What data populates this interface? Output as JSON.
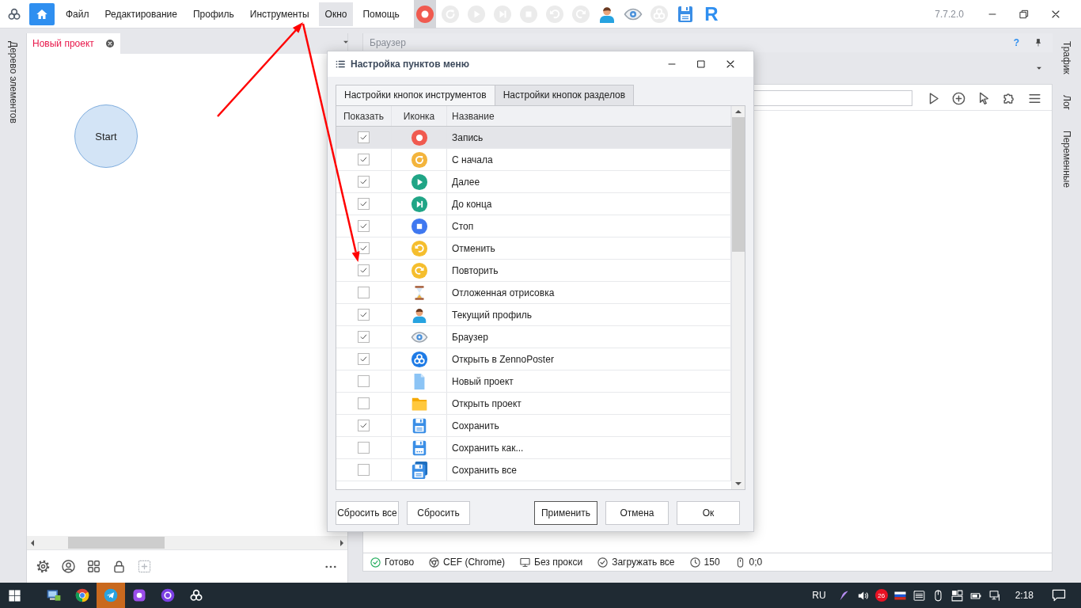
{
  "menu": [
    {
      "label": "Файл",
      "selected": false
    },
    {
      "label": "Редактирование",
      "selected": false
    },
    {
      "label": "Профиль",
      "selected": false
    },
    {
      "label": "Инструменты",
      "selected": false
    },
    {
      "label": "Окно",
      "selected": true
    },
    {
      "label": "Помощь",
      "selected": false
    }
  ],
  "toolbar": [
    {
      "kind": "record",
      "disabled": false,
      "selected": true
    },
    {
      "kind": "restart",
      "disabled": true,
      "selected": false
    },
    {
      "kind": "play",
      "disabled": true,
      "selected": false
    },
    {
      "kind": "toend",
      "disabled": true,
      "selected": false
    },
    {
      "kind": "stop",
      "disabled": true,
      "selected": false
    },
    {
      "kind": "undo",
      "disabled": true,
      "selected": false
    },
    {
      "kind": "redo",
      "disabled": true,
      "selected": false
    },
    {
      "kind": "person",
      "disabled": false,
      "selected": false
    },
    {
      "kind": "eye",
      "disabled": false,
      "selected": false
    },
    {
      "kind": "zenno",
      "disabled": true,
      "selected": false
    },
    {
      "kind": "save",
      "disabled": false,
      "selected": false
    },
    {
      "kind": "text-logo",
      "label": "R",
      "disabled": false,
      "selected": false
    }
  ],
  "version": "7.7.2.0",
  "left_sidebar": {
    "label": "Дерево элементов"
  },
  "project_tab": {
    "label": "Новый проект"
  },
  "canvas": {
    "nodes": [
      {
        "label": "Start"
      }
    ]
  },
  "browser_panel": {
    "title": "Браузер",
    "help": "?"
  },
  "right_sidebar": [
    {
      "label": "Трафик"
    },
    {
      "label": "Лог"
    },
    {
      "label": "Переменные"
    }
  ],
  "status_bar": [
    {
      "kind": "ok",
      "text": "Готово"
    },
    {
      "kind": "chrome",
      "text": "CEF (Chrome)"
    },
    {
      "kind": "monitor",
      "text": "Без прокси"
    },
    {
      "kind": "checkbadge",
      "text": "Загружать все"
    },
    {
      "kind": "clock",
      "text": "150"
    },
    {
      "kind": "mouse",
      "text": "0;0"
    }
  ],
  "dialog": {
    "title": "Настройка пунктов меню",
    "tabs": [
      {
        "label": "Настройки кнопок инструментов",
        "selected": true
      },
      {
        "label": "Настройки кнопок разделов",
        "selected": false
      }
    ],
    "columns": [
      "Показать",
      "Иконка",
      "Название"
    ],
    "rows": [
      {
        "checked": true,
        "kind": "record",
        "name": "Запись",
        "selected": true
      },
      {
        "checked": true,
        "kind": "restart",
        "name": "С начала",
        "selected": false
      },
      {
        "checked": true,
        "kind": "play",
        "name": "Далее",
        "selected": false
      },
      {
        "checked": true,
        "kind": "toend",
        "name": "До конца",
        "selected": false
      },
      {
        "checked": true,
        "kind": "stop",
        "name": "Стоп",
        "selected": false
      },
      {
        "checked": true,
        "kind": "undo",
        "name": "Отменить",
        "selected": false
      },
      {
        "checked": true,
        "kind": "redo",
        "name": "Повторить",
        "selected": false
      },
      {
        "checked": false,
        "kind": "hourglass",
        "name": "Отложенная отрисовка",
        "selected": false
      },
      {
        "checked": true,
        "kind": "person",
        "name": "Текущий профиль",
        "selected": false
      },
      {
        "checked": true,
        "kind": "eye",
        "name": "Браузер",
        "selected": false
      },
      {
        "checked": true,
        "kind": "zenno",
        "name": "Открыть в ZennoPoster",
        "selected": false
      },
      {
        "checked": false,
        "kind": "file",
        "name": "Новый проект",
        "selected": false
      },
      {
        "checked": false,
        "kind": "folder",
        "name": "Открыть проект",
        "selected": false
      },
      {
        "checked": true,
        "kind": "save",
        "name": "Сохранить",
        "selected": false
      },
      {
        "checked": false,
        "kind": "saveas",
        "name": "Сохранить как...",
        "selected": false
      },
      {
        "checked": false,
        "kind": "saveall",
        "name": "Сохранить все",
        "selected": false
      }
    ],
    "buttons": [
      {
        "label": "Сбросить все",
        "default": false
      },
      {
        "label": "Сбросить",
        "default": false
      },
      {
        "label": "Применить",
        "default": true
      },
      {
        "label": "Отмена",
        "default": false
      },
      {
        "label": "Ок",
        "default": false
      }
    ]
  },
  "taskbar": {
    "apps": [
      {
        "kind": "pcapp",
        "active": false
      },
      {
        "kind": "chromeapp",
        "active": false
      },
      {
        "kind": "telegram",
        "active": true
      },
      {
        "kind": "purpleapp",
        "active": false
      },
      {
        "kind": "purplebrowser",
        "active": false
      },
      {
        "kind": "logo",
        "active": false
      }
    ],
    "language": "RU",
    "badge": "26",
    "time": "2:18"
  }
}
